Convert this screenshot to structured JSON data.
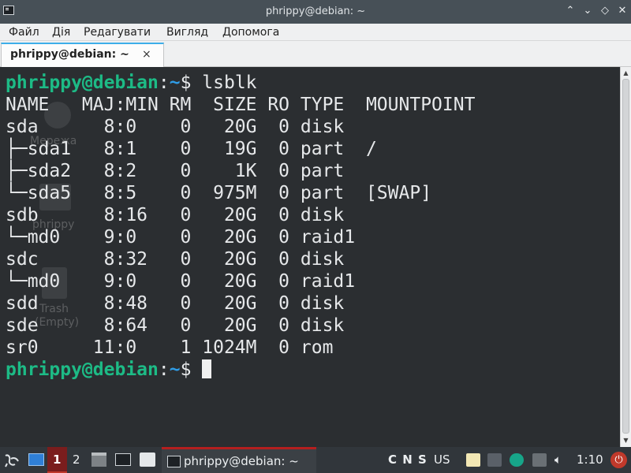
{
  "window": {
    "title": "phrippy@debian: ~",
    "buttons": [
      "shade",
      "minimize",
      "maximize",
      "close"
    ]
  },
  "menu": [
    "Файл",
    "Дія",
    "Редагувати",
    "Вигляд",
    "Допомога"
  ],
  "tab": {
    "label": "phrippy@debian: ~",
    "close_glyph": "×"
  },
  "terminal": {
    "user": "phrippy@debian",
    "sep": ":",
    "path": "~",
    "dollar": "$ ",
    "command": "lsblk",
    "output": [
      "NAME   MAJ:MIN RM  SIZE RO TYPE  MOUNTPOINT",
      "sda      8:0    0   20G  0 disk",
      "├─sda1   8:1    0   19G  0 part  /",
      "├─sda2   8:2    0    1K  0 part",
      "└─sda5   8:5    0  975M  0 part  [SWAP]",
      "sdb      8:16   0   20G  0 disk",
      "└─md0    9:0    0   20G  0 raid1",
      "sdc      8:32   0   20G  0 disk",
      "└─md0    9:0    0   20G  0 raid1",
      "sdd      8:48   0   20G  0 disk",
      "sde      8:64   0   20G  0 disk",
      "sr0     11:0    1 1024M  0 rom"
    ]
  },
  "desktop_icons": [
    {
      "label": "Мережа"
    },
    {
      "label": "phrippy"
    },
    {
      "label": "Trash"
    },
    {
      "label": "(Empty)"
    }
  ],
  "taskbar": {
    "desktops": [
      "1",
      "2"
    ],
    "task_label": "phrippy@debian: ~",
    "indicators": "C N S",
    "keyboard_layout": "US",
    "clock": "1:10"
  },
  "colors": {
    "user": "#1dbb86",
    "path": "#2f9ce6",
    "active_desktop": "#7a1d1d",
    "tab_accent": "#3daee9"
  }
}
